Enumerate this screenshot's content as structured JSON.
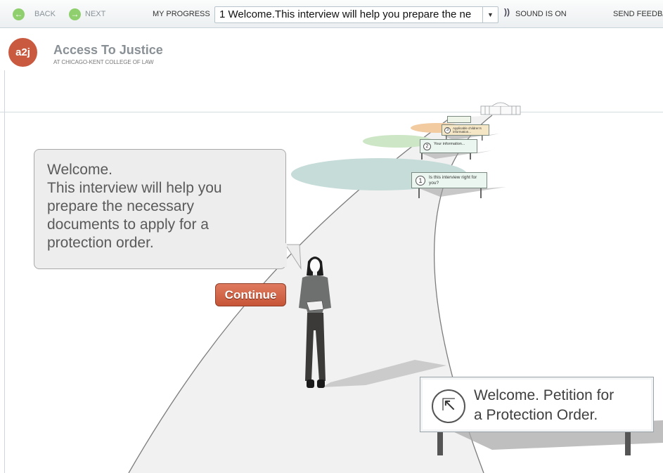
{
  "toolbar": {
    "back_label": "BACK",
    "next_label": "NEXT",
    "progress_label": "MY PROGRESS",
    "progress_value": "1 Welcome.This interview will help you prepare the ne",
    "sound_label": "SOUND IS ON",
    "feedback_label": "SEND FEEDBA"
  },
  "brand": {
    "logo": "a2j",
    "title": "Access To Justice",
    "subtitle": "AT CHICAGO-KENT COLLEGE OF LAW"
  },
  "bubble": {
    "lines": [
      "Welcome.",
      "This interview will help you",
      "prepare the necessary",
      "documents to apply for a",
      "protection order."
    ]
  },
  "continue_label": "Continue",
  "big_sign": {
    "line1": "Welcome. Petition for",
    "line2": "a Protection Order."
  },
  "road_signs": [
    {
      "number": "1",
      "text": "Is this interview right for you?"
    },
    {
      "number": "2",
      "text": "Your information..."
    },
    {
      "number": "3",
      "text": "Applicable children's information..."
    }
  ],
  "colors": {
    "accent": "#c95a3f",
    "continue": "#d4684b",
    "nav_green": "#8fcf6e",
    "road": "#f0f0f0",
    "disc_teal": "#c5dcd9",
    "disc_green": "#cde5c5",
    "disc_orange": "#f1caa0"
  }
}
